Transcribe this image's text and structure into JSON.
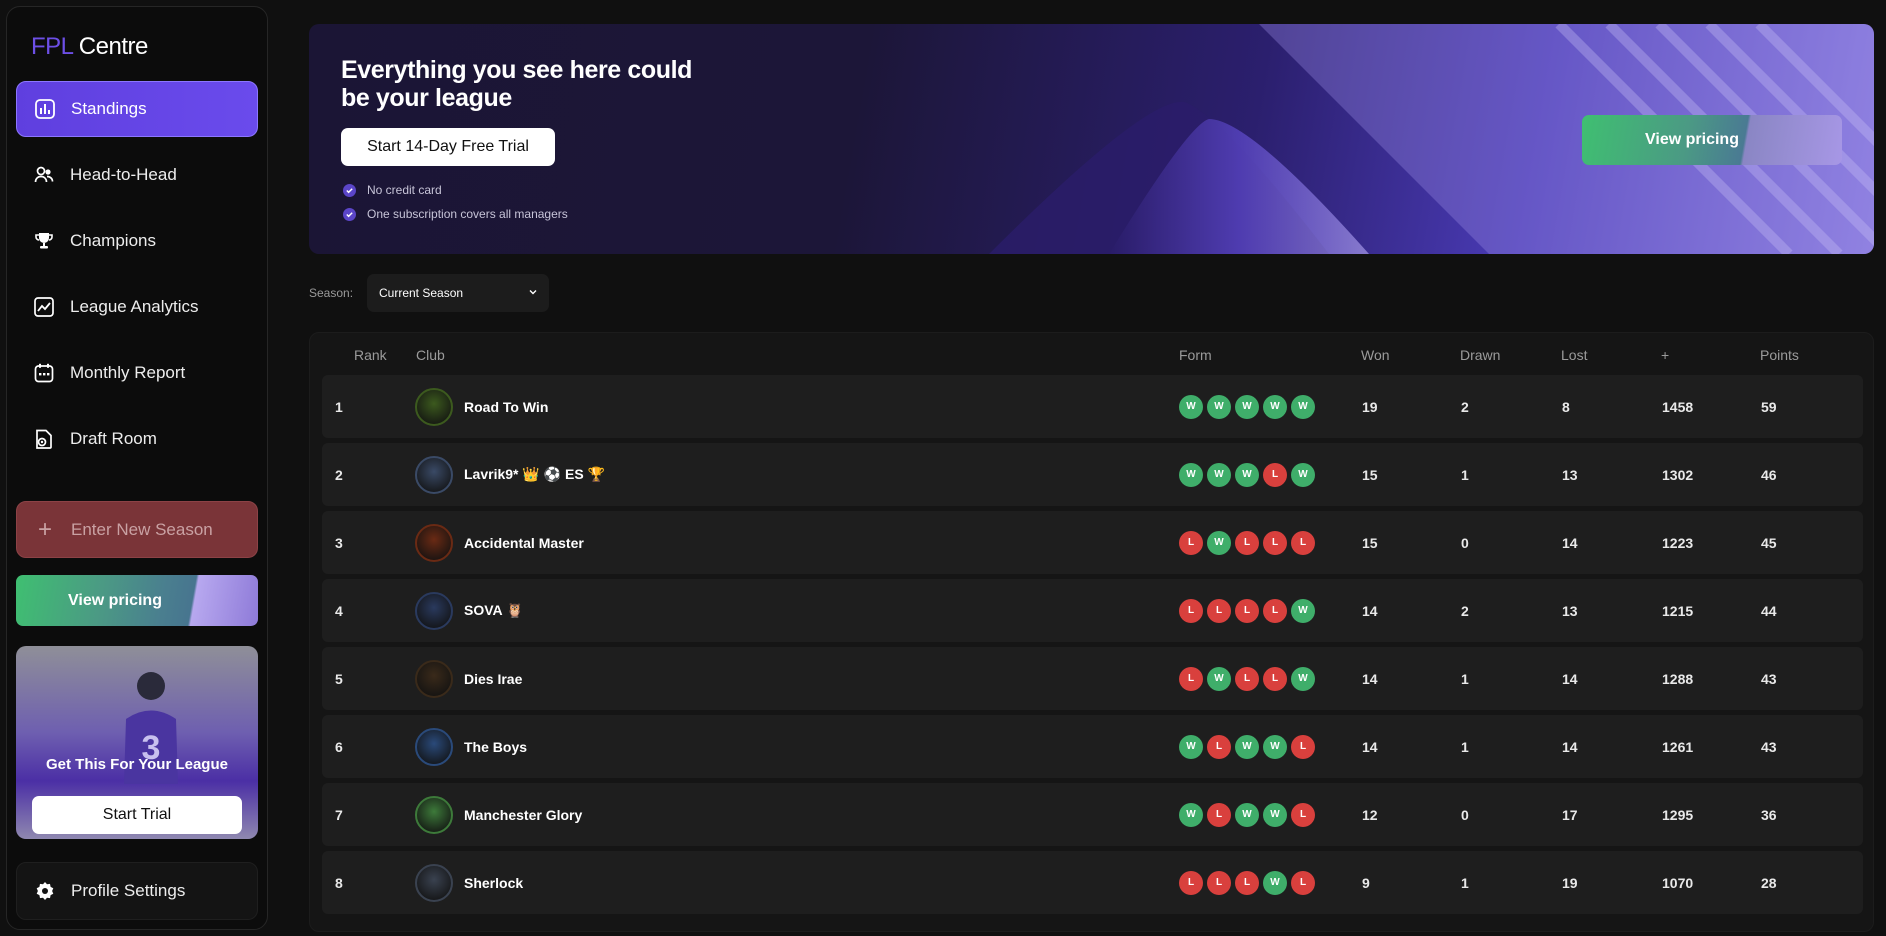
{
  "app": {
    "logo_accent": "FPL",
    "logo_main": "Centre"
  },
  "sidebar": {
    "nav": [
      {
        "label": "Standings",
        "icon": "bar-chart-icon",
        "active": true
      },
      {
        "label": "Head-to-Head",
        "icon": "users-icon",
        "active": false
      },
      {
        "label": "Champions",
        "icon": "trophy-icon",
        "active": false
      },
      {
        "label": "League Analytics",
        "icon": "analytics-icon",
        "active": false
      },
      {
        "label": "Monthly Report",
        "icon": "calendar-icon",
        "active": false
      },
      {
        "label": "Draft Room",
        "icon": "draft-document-icon",
        "active": false
      }
    ],
    "new_season_label": "Enter New Season",
    "pricing_label": "View pricing",
    "promo": {
      "title": "Get This For Your League",
      "button": "Start Trial"
    },
    "profile_label": "Profile Settings"
  },
  "hero": {
    "title": "Everything you see here could be your league",
    "trial_button": "Start 14-Day Free Trial",
    "bullets": [
      "No credit card",
      "One subscription covers all managers"
    ],
    "pricing_button": "View pricing"
  },
  "filter": {
    "season_label": "Season:",
    "season_value": "Current Season"
  },
  "table": {
    "headers": [
      "Rank",
      "Club",
      "Form",
      "Won",
      "Drawn",
      "Lost",
      "+",
      "Points"
    ],
    "rows": [
      {
        "rank": "1",
        "club": "Road To Win",
        "form": [
          "W",
          "W",
          "W",
          "W",
          "W"
        ],
        "won": "19",
        "drawn": "2",
        "lost": "8",
        "plus": "1458",
        "points": "59",
        "badge_color": "#3c5a1e"
      },
      {
        "rank": "2",
        "club": "Lavrik9* 👑 ⚽ ES 🏆",
        "form": [
          "W",
          "W",
          "W",
          "L",
          "W"
        ],
        "won": "15",
        "drawn": "1",
        "lost": "13",
        "plus": "1302",
        "points": "46",
        "badge_color": "#3a4a66"
      },
      {
        "rank": "3",
        "club": "Accidental Master",
        "form": [
          "L",
          "W",
          "L",
          "L",
          "L"
        ],
        "won": "15",
        "drawn": "0",
        "lost": "14",
        "plus": "1223",
        "points": "45",
        "badge_color": "#6a2a14"
      },
      {
        "rank": "4",
        "club": "SOVA 🦉",
        "form": [
          "L",
          "L",
          "L",
          "L",
          "W"
        ],
        "won": "14",
        "drawn": "2",
        "lost": "13",
        "plus": "1215",
        "points": "44",
        "badge_color": "#2a3a5e"
      },
      {
        "rank": "5",
        "club": "Dies Irae",
        "form": [
          "L",
          "W",
          "L",
          "L",
          "W"
        ],
        "won": "14",
        "drawn": "1",
        "lost": "14",
        "plus": "1288",
        "points": "43",
        "badge_color": "#3a2a1a"
      },
      {
        "rank": "6",
        "club": "The Boys",
        "form": [
          "W",
          "L",
          "W",
          "W",
          "L"
        ],
        "won": "14",
        "drawn": "1",
        "lost": "14",
        "plus": "1261",
        "points": "43",
        "badge_color": "#2a4a7a"
      },
      {
        "rank": "7",
        "club": "Manchester Glory",
        "form": [
          "W",
          "L",
          "W",
          "W",
          "L"
        ],
        "won": "12",
        "drawn": "0",
        "lost": "17",
        "plus": "1295",
        "points": "36",
        "badge_color": "#3d7a3a"
      },
      {
        "rank": "8",
        "club": "Sherlock",
        "form": [
          "L",
          "L",
          "L",
          "W",
          "L"
        ],
        "won": "9",
        "drawn": "1",
        "lost": "19",
        "plus": "1070",
        "points": "28",
        "badge_color": "#3a4250"
      }
    ]
  },
  "colors": {
    "accent": "#6a4bec",
    "win": "#3fae6a",
    "loss": "#d9403d"
  }
}
